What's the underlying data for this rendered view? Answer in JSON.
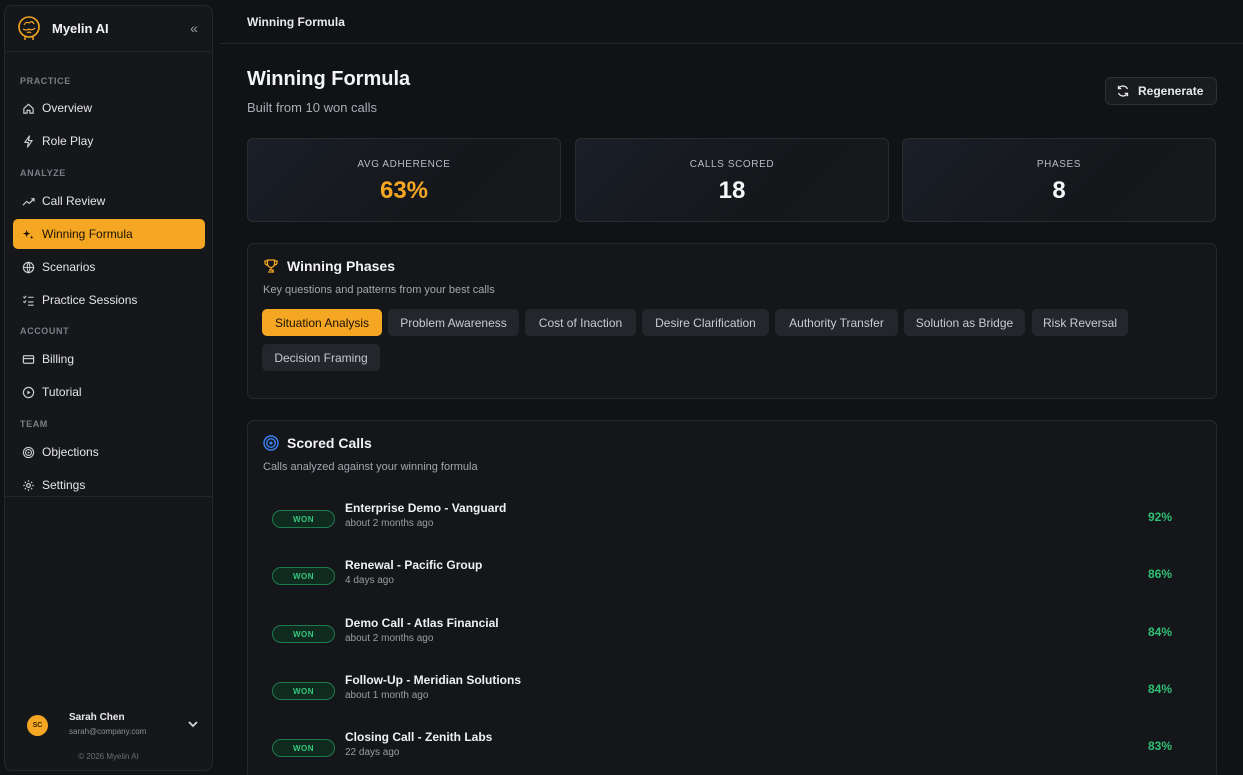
{
  "brand": {
    "name": "Myelin AI"
  },
  "sidebar": {
    "sections": {
      "practice": "PRACTICE",
      "analyze": "ANALYZE",
      "account": "ACCOUNT",
      "team": "TEAM"
    },
    "items": [
      {
        "label": "Overview",
        "icon": "home-icon"
      },
      {
        "label": "Role Play",
        "icon": "lightning-icon"
      },
      {
        "label": "Call Review",
        "icon": "trend-icon"
      },
      {
        "label": "Winning Formula",
        "icon": "sparkles-icon",
        "active": true
      },
      {
        "label": "Scenarios",
        "icon": "globe-icon"
      },
      {
        "label": "Practice Sessions",
        "icon": "checklist-icon"
      },
      {
        "label": "Billing",
        "icon": "card-icon"
      },
      {
        "label": "Tutorial",
        "icon": "play-circle-icon"
      },
      {
        "label": "Objections",
        "icon": "target-icon"
      },
      {
        "label": "Settings",
        "icon": "gear-icon"
      }
    ]
  },
  "user": {
    "initials": "SC",
    "name": "Sarah Chen",
    "email": "sarah@company.com"
  },
  "copyright": "© 2026 Myelin AI",
  "topbar": {
    "title": "Winning Formula"
  },
  "page": {
    "title": "Winning Formula",
    "subtitle": "Built from 10 won calls",
    "regenerate_label": "Regenerate"
  },
  "stats": [
    {
      "label": "AVG ADHERENCE",
      "value": "63%"
    },
    {
      "label": "CALLS SCORED",
      "value": "18"
    },
    {
      "label": "PHASES",
      "value": "8"
    }
  ],
  "phases": {
    "title": "Winning Phases",
    "subtitle": "Key questions and patterns from your best calls",
    "chips": [
      "Situation Analysis",
      "Problem Awareness",
      "Cost of Inaction",
      "Desire Clarification",
      "Authority Transfer",
      "Solution as Bridge",
      "Risk Reversal",
      "Decision Framing"
    ],
    "active_chip": "Situation Analysis"
  },
  "scored": {
    "title": "Scored Calls",
    "subtitle": "Calls analyzed against your winning formula",
    "calls": [
      {
        "status": "WON",
        "title": "Enterprise Demo - Vanguard",
        "time": "about 2 months ago",
        "score": "92%"
      },
      {
        "status": "WON",
        "title": "Renewal - Pacific Group",
        "time": "4 days ago",
        "score": "86%"
      },
      {
        "status": "WON",
        "title": "Demo Call - Atlas Financial",
        "time": "about 2 months ago",
        "score": "84%"
      },
      {
        "status": "WON",
        "title": "Follow-Up - Meridian Solutions",
        "time": "about 1 month ago",
        "score": "84%"
      },
      {
        "status": "WON",
        "title": "Closing Call - Zenith Labs",
        "time": "22 days ago",
        "score": "83%"
      }
    ]
  },
  "colors": {
    "accent": "#f5a623",
    "success": "#2fbf76",
    "background": "#111215"
  }
}
